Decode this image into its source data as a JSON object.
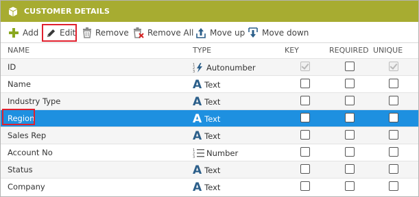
{
  "header": {
    "title": "CUSTOMER DETAILS",
    "icon": "cube-icon"
  },
  "toolbar": {
    "add": "Add",
    "edit": "Edit",
    "remove": "Remove",
    "remove_all": "Remove All",
    "move_up": "Move up",
    "move_down": "Move down"
  },
  "columns": {
    "name": "NAME",
    "type": "TYPE",
    "key": "KEY",
    "required": "REQUIRED",
    "unique": "UNIQUE"
  },
  "rows": [
    {
      "name": "ID",
      "type": "Autonumber",
      "type_icon": "autonumber-icon",
      "key": true,
      "required": false,
      "unique": true,
      "disabled": true
    },
    {
      "name": "Name",
      "type": "Text",
      "type_icon": "text-type-icon",
      "key": false,
      "required": false,
      "unique": false
    },
    {
      "name": "Industry Type",
      "type": "Text",
      "type_icon": "text-type-icon",
      "key": false,
      "required": false,
      "unique": false
    },
    {
      "name": "Region",
      "type": "Text",
      "type_icon": "text-type-icon",
      "key": false,
      "required": false,
      "unique": false,
      "selected": true
    },
    {
      "name": "Sales Rep",
      "type": "Text",
      "type_icon": "text-type-icon",
      "key": false,
      "required": false,
      "unique": false
    },
    {
      "name": "Account No",
      "type": "Number",
      "type_icon": "number-list-icon",
      "key": false,
      "required": false,
      "unique": false
    },
    {
      "name": "Status",
      "type": "Text",
      "type_icon": "text-type-icon",
      "key": false,
      "required": false,
      "unique": false
    },
    {
      "name": "Company",
      "type": "Text",
      "type_icon": "text-type-icon",
      "key": false,
      "required": false,
      "unique": false
    }
  ],
  "colors": {
    "header": "#a7ac31",
    "selected_row": "#1e90e0",
    "highlight": "#e0202d",
    "text_icon": "#2c5f8a"
  }
}
